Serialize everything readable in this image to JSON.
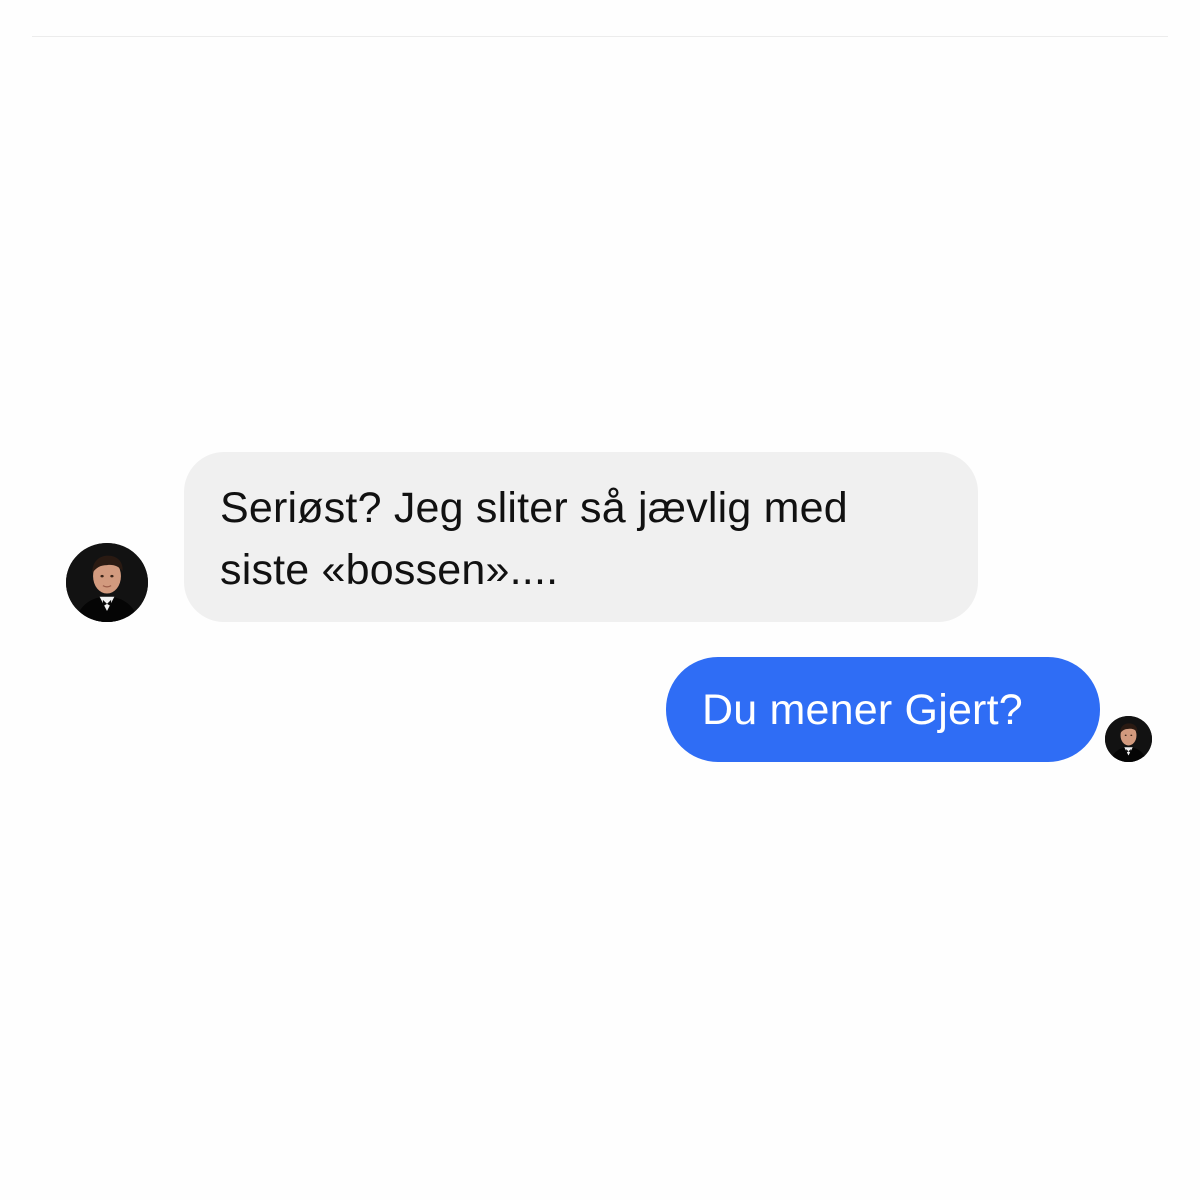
{
  "conversation": {
    "messages": [
      {
        "sender": "other",
        "text": "Seriøst? Jeg sliter så jævlig med siste «bossen»....",
        "avatar_icon": "person-avatar-icon"
      },
      {
        "sender": "self",
        "text": "Du mener Gjert?",
        "avatar_icon": "person-avatar-icon"
      }
    ]
  },
  "colors": {
    "incoming_bubble": "#f0f0f0",
    "outgoing_bubble": "#2f6df5",
    "incoming_text": "#111111",
    "outgoing_text": "#ffffff",
    "background": "#fefefe"
  }
}
